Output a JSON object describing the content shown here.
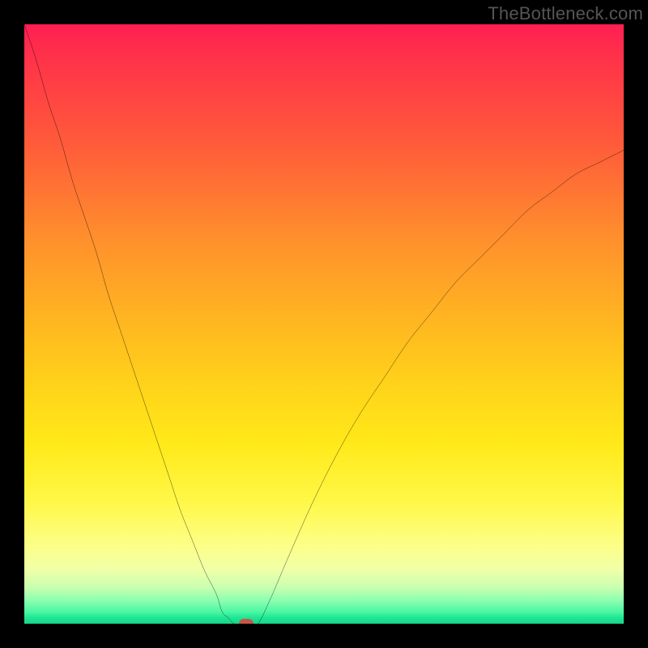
{
  "watermark": "TheBottleneck.com",
  "colors": {
    "frame_border": "#000000",
    "curve": "#000000",
    "marker": "#c6564a",
    "gradient_top": "#ff1f52",
    "gradient_mid": "#ffe919",
    "gradient_bottom": "#18d68b"
  },
  "chart_data": {
    "type": "line",
    "title": "",
    "xlabel": "",
    "ylabel": "",
    "xlim": [
      0,
      100
    ],
    "ylim": [
      0,
      100
    ],
    "grid": false,
    "legend_position": "none",
    "annotations": [
      {
        "text": "TheBottleneck.com",
        "position": "top-right"
      }
    ],
    "marker": {
      "x": 37,
      "y": 0
    },
    "series": [
      {
        "name": "bottleneck_curve_left",
        "x": [
          0,
          2,
          4,
          6,
          8,
          10,
          12,
          14,
          16,
          18,
          20,
          22,
          24,
          26,
          28,
          30,
          32,
          33,
          34,
          35
        ],
        "values": [
          100,
          94,
          87,
          81,
          74,
          68,
          62,
          55,
          49,
          43,
          37,
          31,
          25,
          19,
          14,
          9,
          5,
          2,
          1,
          0
        ]
      },
      {
        "name": "flat_bottom",
        "x": [
          35,
          36,
          37,
          38,
          39
        ],
        "values": [
          0,
          0,
          0,
          0,
          0
        ]
      },
      {
        "name": "bottleneck_curve_right",
        "x": [
          39,
          41,
          44,
          48,
          52,
          56,
          60,
          64,
          68,
          72,
          76,
          80,
          84,
          88,
          92,
          96,
          100
        ],
        "values": [
          0,
          4,
          11,
          20,
          28,
          35,
          41,
          47,
          52,
          57,
          61,
          65,
          69,
          72,
          75,
          77,
          79
        ]
      }
    ]
  }
}
